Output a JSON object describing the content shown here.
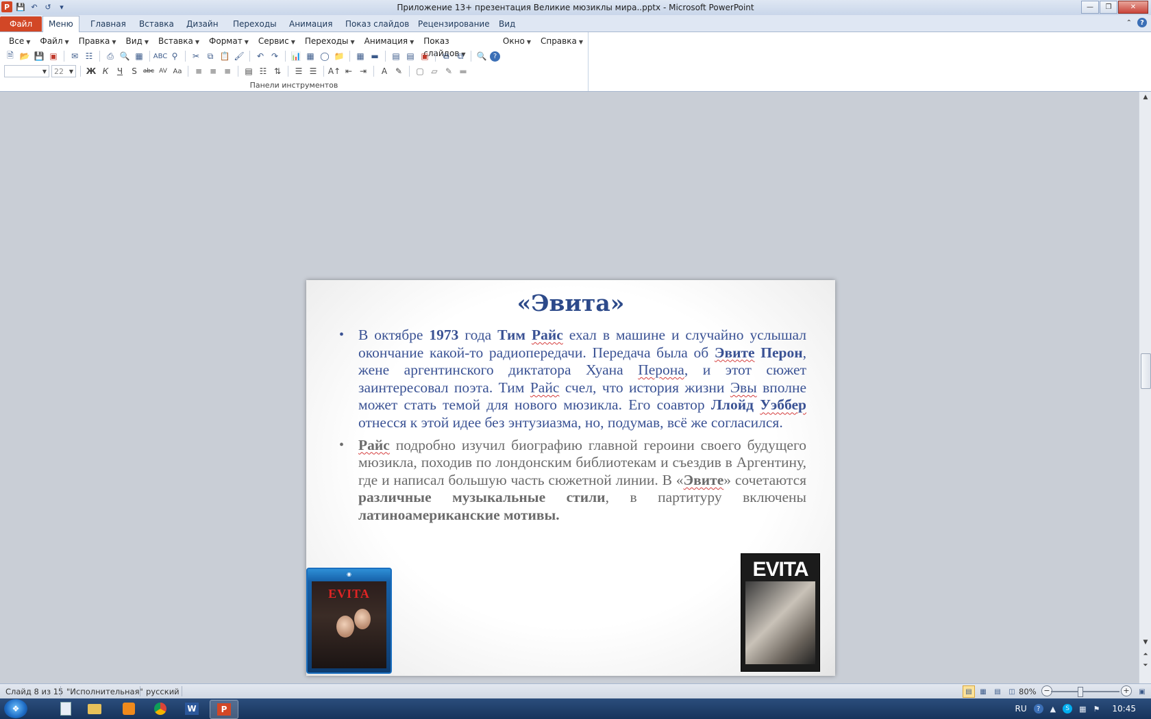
{
  "window": {
    "title": "Приложение 13+ презентация Великие мюзиклы мира..pptx  -  Microsoft PowerPoint"
  },
  "ribbon": {
    "tabs": [
      "Файл",
      "Меню",
      "Главная",
      "Вставка",
      "Дизайн",
      "Переходы",
      "Анимация",
      "Показ слайдов",
      "Рецензирование",
      "Вид"
    ],
    "active_tab": "Меню",
    "menu_items": [
      "Все",
      "Файл",
      "Правка",
      "Вид",
      "Вставка",
      "Формат",
      "Сервис",
      "Переходы",
      "Анимация",
      "Показ слайдов",
      "Окно",
      "Справка"
    ],
    "font_size_value": "22",
    "group_label": "Панели инструментов"
  },
  "slide": {
    "title": "«Эвита»",
    "bullet1": {
      "t1": "В октябре ",
      "b1": "1973",
      "t2": " года ",
      "b2": "Тим ",
      "b3": "Райс",
      "t3": " ехал в машине и случайно услышал окончание какой-то радиопередачи. Передача была об ",
      "b4": "Эвите",
      "b5": " Перон",
      "t4": ", жене аргентинского диктатора Хуана ",
      "t5": "Перона",
      "t6": ", и этот сюжет заинтересовал поэта. Тим ",
      "t7": "Райс",
      "t8": " счел, что история жизни ",
      "t9": "Эвы",
      "t10": " вполне может стать темой для нового мюзикла. Его соавтор ",
      "b6": "Ллойд ",
      "b7": "Уэббер",
      "t11": " отнесся к этой идее без энтузиазма, но, подумав, всё же согласился."
    },
    "bullet2": {
      "b1": "Райс",
      "t1": " подробно изучил биографию главной героини своего будущего мюзикла, походив по лондонским библиотекам и съездив в Аргентину, где и написал большую часть сюжетной линии. В «",
      "t2": "Эвите",
      "t3": "» сочетаются ",
      "b2": "различные музыкальные стили",
      "t4": ", в партитуру включены ",
      "b3": "латиноамериканские мотивы."
    },
    "cover_left_title": "EVITA",
    "cover_right_title": "EVITA"
  },
  "status": {
    "slide_counter": "Слайд 8 из 15",
    "theme": "\"Исполнительная\"",
    "language": "русский",
    "zoom": "80%"
  },
  "taskbar": {
    "tray_lang": "RU",
    "clock": "10:45"
  },
  "colors": {
    "title_blue": "#2d4a8a",
    "text_blue": "#3a5294",
    "text_gray": "#6b6b6b",
    "file_tab": "#d24726"
  }
}
